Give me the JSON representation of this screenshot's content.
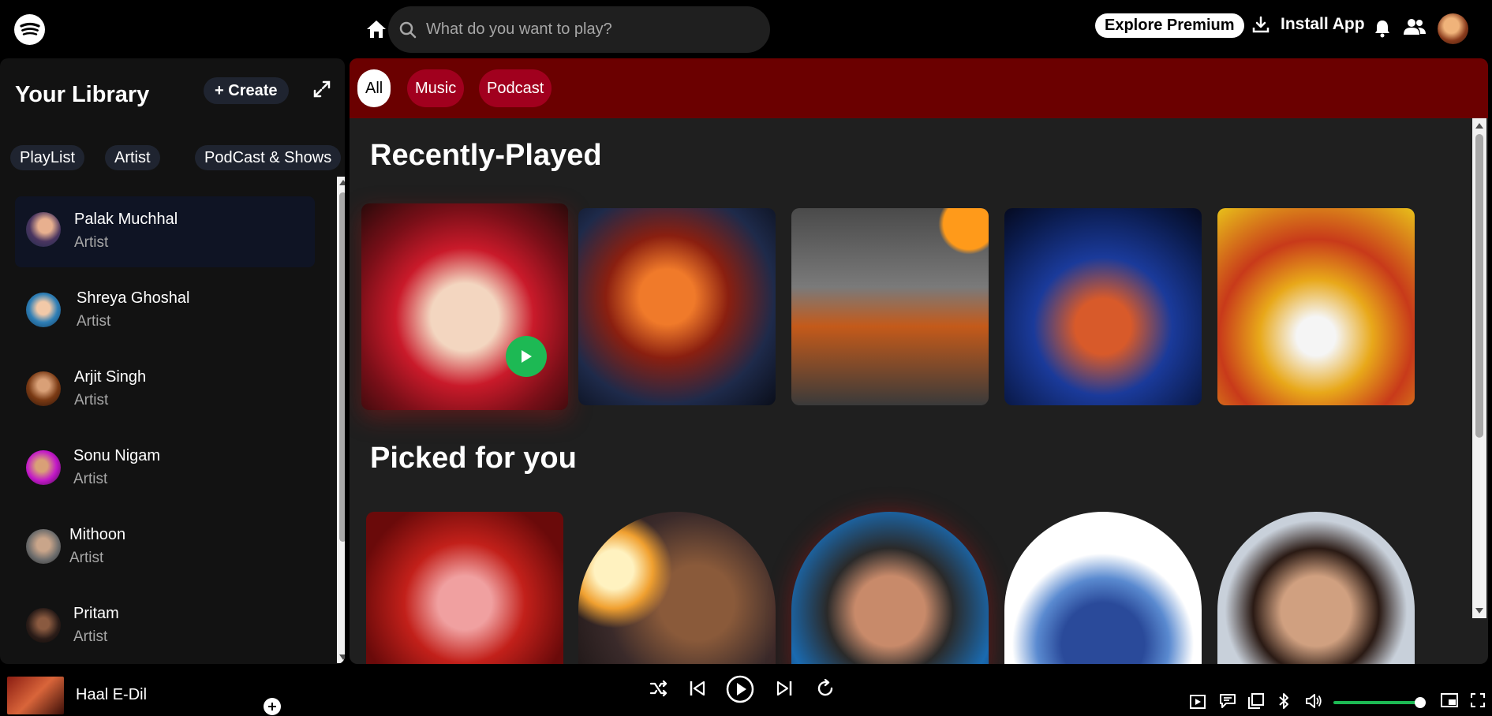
{
  "header": {
    "search_placeholder": "What do you want to play?",
    "explore_label": "Explore Premium",
    "install_label": "Install App"
  },
  "sidebar": {
    "title": "Your Library",
    "create_label": "Create",
    "filters": [
      "PlayList",
      "Artist",
      "PodCast & Shows"
    ],
    "items": [
      {
        "name": "Palak Muchhal",
        "role": "Artist"
      },
      {
        "name": "Shreya Ghoshal",
        "role": "Artist"
      },
      {
        "name": "Arjit Singh",
        "role": "Artist"
      },
      {
        "name": "Sonu Nigam",
        "role": "Artist"
      },
      {
        "name": "Mithoon",
        "role": "Artist"
      },
      {
        "name": "Pritam",
        "role": "Artist"
      }
    ]
  },
  "main": {
    "tabs": [
      "All",
      "Music",
      "Podcast"
    ],
    "sections": [
      {
        "title": "Recently-Played"
      },
      {
        "title": "Picked for you"
      }
    ]
  },
  "player": {
    "track_title": "Haal E-Dil",
    "volume_level": 0.95
  },
  "colors": {
    "accent": "#1db954",
    "header_band": "#6b0000",
    "tab_inactive": "#a1001e",
    "chip_bg": "#1f2430"
  }
}
